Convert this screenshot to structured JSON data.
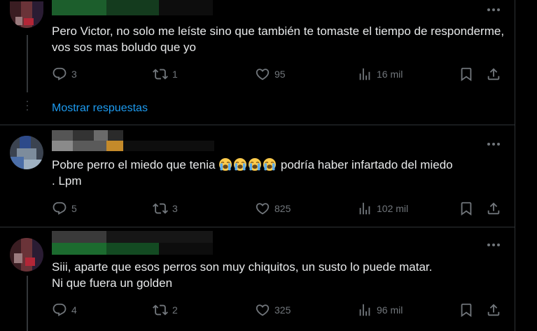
{
  "replies": [
    {
      "text": "Pero Victor, no solo me leíste sino que también te tomaste el tiempo de responderme, vos sos mas boludo que yo",
      "stats": {
        "replies": "3",
        "retweets": "1",
        "likes": "95",
        "views": "16 mil"
      }
    },
    {
      "text_before": "Pobre perro el miedo que tenia ",
      "emoji": "loudly-crying-face",
      "emoji_count": 4,
      "text_after": " podría haber infartado del miedo\n. Lpm",
      "stats": {
        "replies": "5",
        "retweets": "3",
        "likes": "825",
        "views": "102 mil"
      }
    },
    {
      "text": "Siii, aparte que esos perros son muy chiquitos, un susto lo puede matar.\nNi que fuera un golden",
      "stats": {
        "replies": "4",
        "retweets": "2",
        "likes": "325",
        "views": "96 mil"
      }
    }
  ],
  "show_replies_label": "Mostrar respuestas",
  "colors": {
    "background": "#000000",
    "text": "#e7e9ea",
    "muted": "#71767b",
    "link": "#1d9bf0",
    "divider": "#2f3336"
  }
}
